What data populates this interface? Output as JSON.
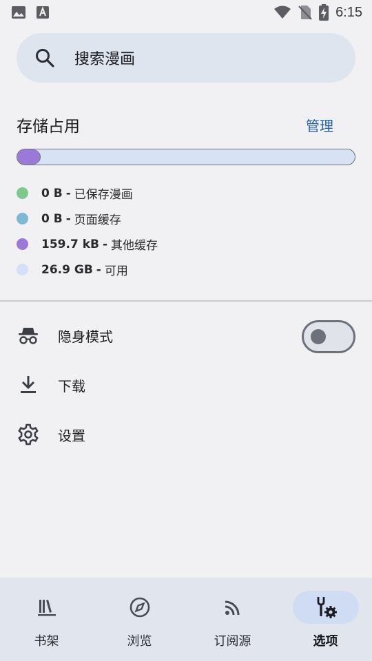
{
  "status_bar": {
    "time": "6:15",
    "left_icons": [
      "image-icon",
      "text-a-icon"
    ],
    "right_icons": [
      "wifi-icon",
      "no-sim-icon",
      "battery-charging-icon"
    ]
  },
  "search": {
    "placeholder": "搜索漫画",
    "icon": "search-icon"
  },
  "storage": {
    "title": "存储占用",
    "manage_label": "管理",
    "used_fraction": 0.07,
    "legend": [
      {
        "value": "0 B",
        "label": "已保存漫画",
        "color": "#7cc98a"
      },
      {
        "value": "0 B",
        "label": "页面缓存",
        "color": "#7fb7d4"
      },
      {
        "value": "159.7 kB",
        "label": "其他缓存",
        "color": "#9b79d6"
      },
      {
        "value": "26.9 GB",
        "label": "可用",
        "color": "#d4e0f6"
      }
    ],
    "separator": "-"
  },
  "menu": {
    "incognito": {
      "label": "隐身模式",
      "icon": "incognito-icon",
      "toggle_on": false
    },
    "downloads": {
      "label": "下载",
      "icon": "download-icon"
    },
    "settings": {
      "label": "设置",
      "icon": "gear-icon"
    }
  },
  "bottom_nav": {
    "items": [
      {
        "label": "书架",
        "icon": "library-icon",
        "active": false
      },
      {
        "label": "浏览",
        "icon": "compass-icon",
        "active": false
      },
      {
        "label": "订阅源",
        "icon": "rss-icon",
        "active": false
      },
      {
        "label": "选项",
        "icon": "tools-gear-icon",
        "active": true
      }
    ]
  },
  "colors": {
    "accent": "#1f5f9e",
    "background": "#f1f1f4",
    "search_bg": "#dfe5ef",
    "nav_bg": "#e0e5ee",
    "active_pill": "#cfdcf4"
  }
}
